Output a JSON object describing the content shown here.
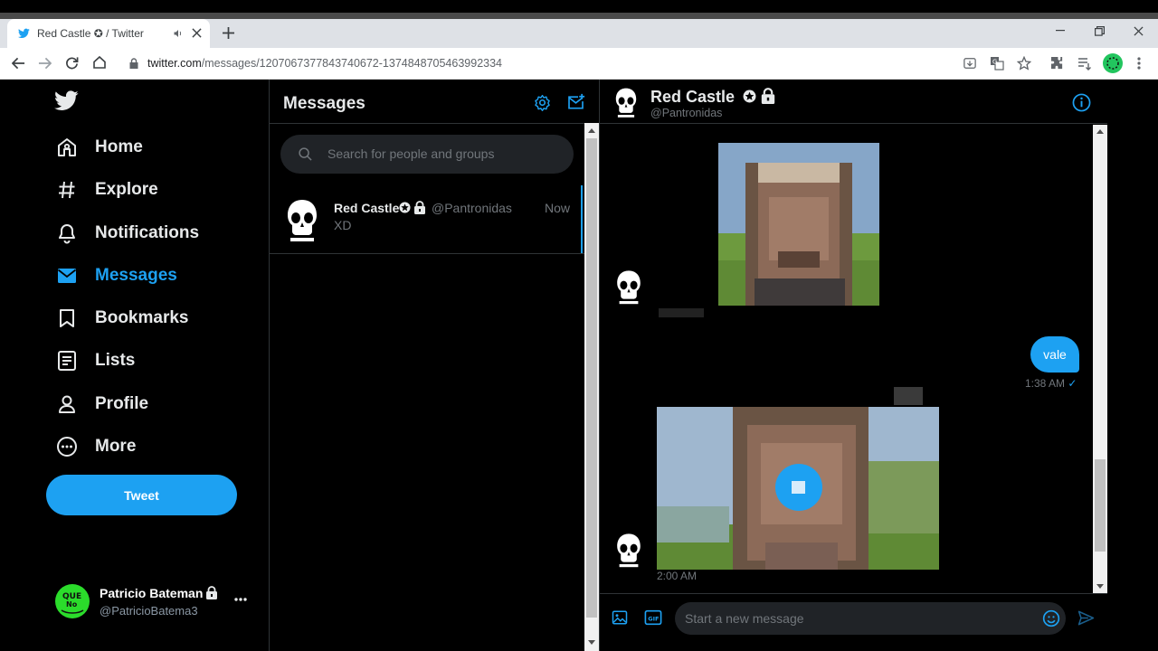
{
  "browser": {
    "tab_title": "Red Castle ✪ / Twitter",
    "url_host": "twitter.com",
    "url_path": "/messages/1207067377843740672-1374848705463992334"
  },
  "nav": {
    "items": [
      {
        "label": "Home",
        "icon": "home-icon"
      },
      {
        "label": "Explore",
        "icon": "hashtag-icon"
      },
      {
        "label": "Notifications",
        "icon": "bell-icon"
      },
      {
        "label": "Messages",
        "icon": "envelope-icon",
        "active": true
      },
      {
        "label": "Bookmarks",
        "icon": "bookmark-icon"
      },
      {
        "label": "Lists",
        "icon": "list-icon"
      },
      {
        "label": "Profile",
        "icon": "person-icon"
      },
      {
        "label": "More",
        "icon": "more-circle-icon"
      }
    ],
    "tweet_label": "Tweet"
  },
  "account": {
    "name": "Patricio Bateman",
    "handle": "@PatricioBatema3"
  },
  "messages": {
    "title": "Messages",
    "search_placeholder": "Search for people and groups",
    "conversations": [
      {
        "name": "Red Castle",
        "handle": "@Pantronidas",
        "time": "Now",
        "preview": "XD"
      }
    ]
  },
  "chat": {
    "name": "Red Castle",
    "handle": "@Pantronidas",
    "sent_message": "vale",
    "sent_time": "1:38 AM",
    "video_time": "2:00 AM",
    "composer_placeholder": "Start a new message"
  },
  "colors": {
    "accent": "#1da1f2",
    "background": "#000000",
    "text": "#e7e9ea",
    "muted": "#71767b"
  }
}
